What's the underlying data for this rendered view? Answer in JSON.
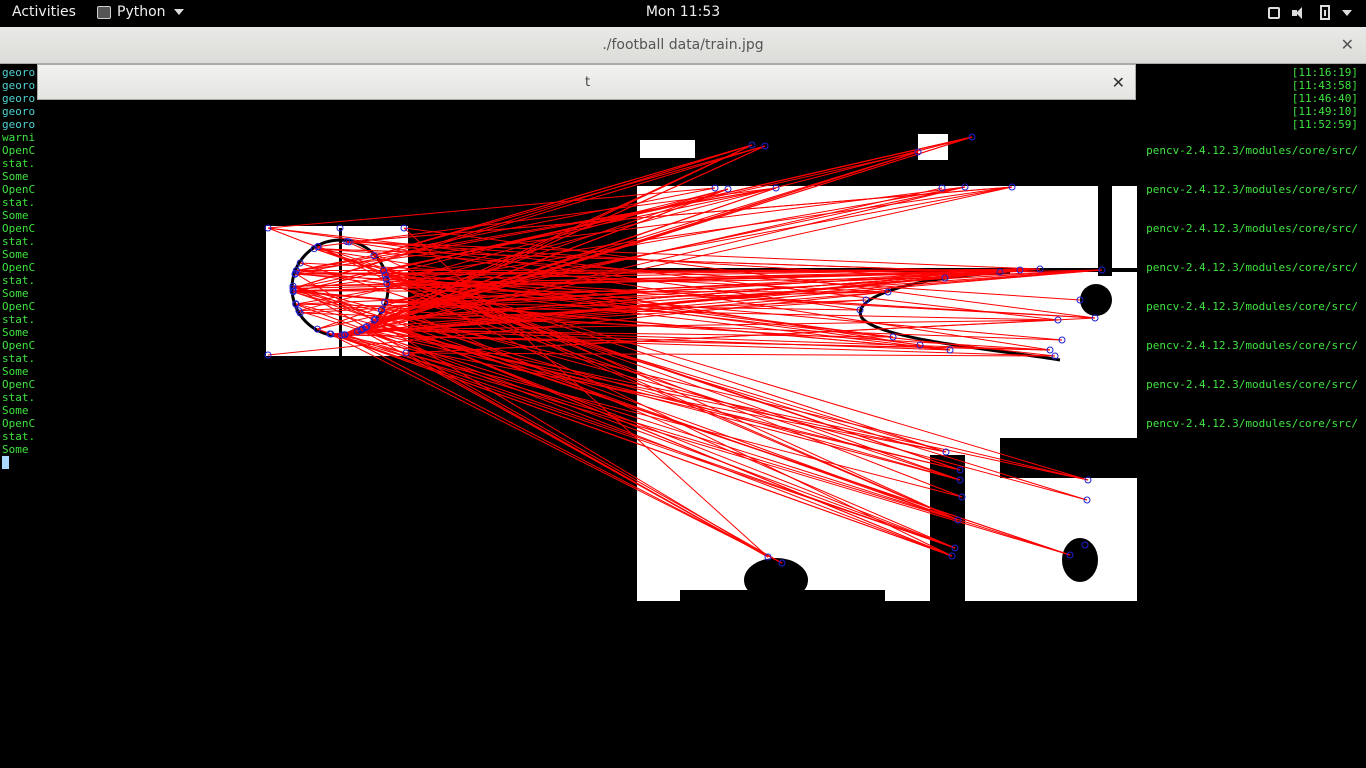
{
  "topbar": {
    "activities": "Activities",
    "app_name": "Python",
    "clock": "Mon 11:53"
  },
  "window": {
    "title": "./football data/train.jpg"
  },
  "terminal": {
    "left_lines": [
      {
        "text": "georo",
        "color": "#4fd1d1"
      },
      {
        "text": "georo",
        "color": "#4fd1d1"
      },
      {
        "text": "georo",
        "color": "#4fd1d1"
      },
      {
        "text": "georo",
        "color": "#4fd1d1"
      },
      {
        "text": "georo",
        "color": "#4fd1d1"
      },
      {
        "text": "warni",
        "color": "#3fe33f"
      },
      {
        "text": "OpenC",
        "color": "#3fe33f"
      },
      {
        "text": "stat.",
        "color": "#3fe33f"
      },
      {
        "text": "Some",
        "color": "#3fe33f"
      },
      {
        "text": "OpenC",
        "color": "#3fe33f"
      },
      {
        "text": "stat.",
        "color": "#3fe33f"
      },
      {
        "text": "Some",
        "color": "#3fe33f"
      },
      {
        "text": "OpenC",
        "color": "#3fe33f"
      },
      {
        "text": "stat.",
        "color": "#3fe33f"
      },
      {
        "text": "Some",
        "color": "#3fe33f"
      },
      {
        "text": "OpenC",
        "color": "#3fe33f"
      },
      {
        "text": "stat.",
        "color": "#3fe33f"
      },
      {
        "text": "Some",
        "color": "#3fe33f"
      },
      {
        "text": "OpenC",
        "color": "#3fe33f"
      },
      {
        "text": "stat.",
        "color": "#3fe33f"
      },
      {
        "text": "Some",
        "color": "#3fe33f"
      },
      {
        "text": "OpenC",
        "color": "#3fe33f"
      },
      {
        "text": "stat.",
        "color": "#3fe33f"
      },
      {
        "text": "Some",
        "color": "#3fe33f"
      },
      {
        "text": "OpenC",
        "color": "#3fe33f"
      },
      {
        "text": "stat.",
        "color": "#3fe33f"
      },
      {
        "text": "Some",
        "color": "#3fe33f"
      },
      {
        "text": "OpenC",
        "color": "#3fe33f"
      },
      {
        "text": "stat.",
        "color": "#3fe33f"
      },
      {
        "text": "Some",
        "color": "#3fe33f"
      }
    ],
    "right_lines": [
      "[11:16:19]",
      "[11:43:58]",
      "[11:46:40]",
      "[11:49:10]",
      "[11:52:59]",
      "",
      "pencv-2.4.12.3/modules/core/src/",
      "",
      "",
      "pencv-2.4.12.3/modules/core/src/",
      "",
      "",
      "pencv-2.4.12.3/modules/core/src/",
      "",
      "",
      "pencv-2.4.12.3/modules/core/src/",
      "",
      "",
      "pencv-2.4.12.3/modules/core/src/",
      "",
      "",
      "pencv-2.4.12.3/modules/core/src/",
      "",
      "",
      "pencv-2.4.12.3/modules/core/src/",
      "",
      "",
      "pencv-2.4.12.3/modules/core/src/"
    ],
    "right_color": "#3fe33f"
  },
  "cv_window": {
    "title": "t"
  },
  "colors": {
    "match_line": "#ff0000",
    "keypoint": "#2020d0"
  }
}
